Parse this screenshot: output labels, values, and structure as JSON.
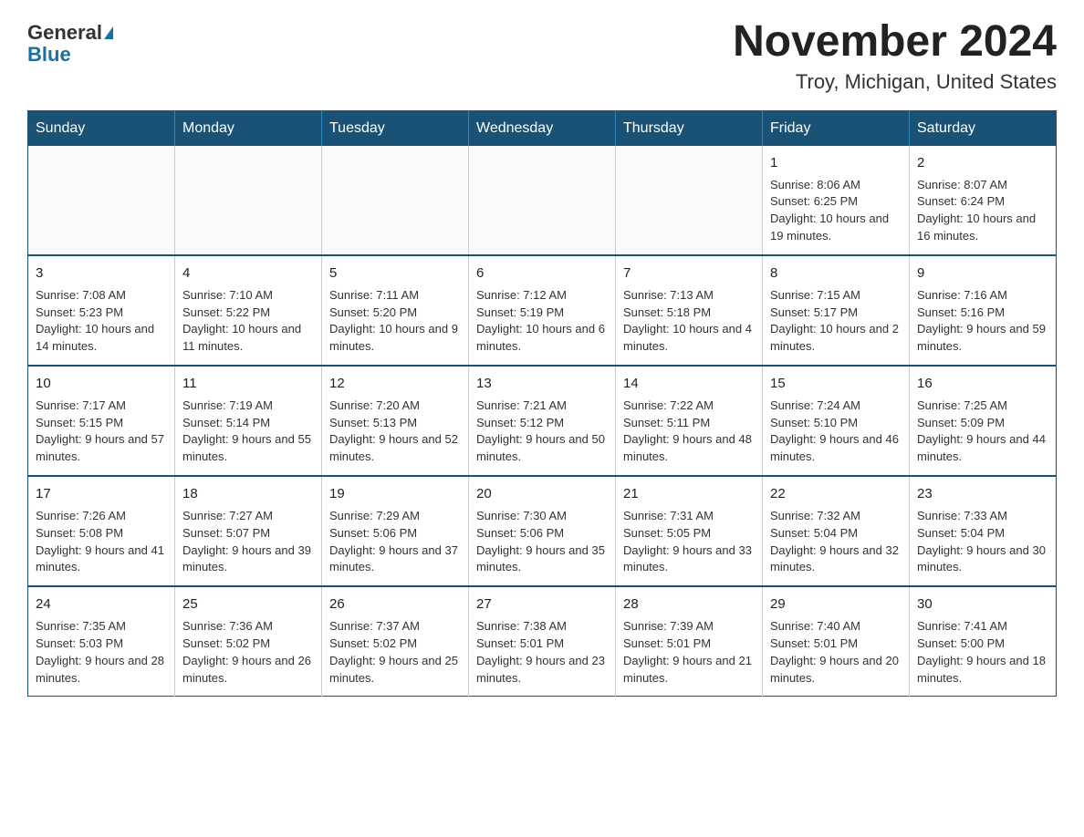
{
  "header": {
    "logo_line1": "General",
    "logo_line2": "Blue",
    "title": "November 2024",
    "subtitle": "Troy, Michigan, United States"
  },
  "days_of_week": [
    "Sunday",
    "Monday",
    "Tuesday",
    "Wednesday",
    "Thursday",
    "Friday",
    "Saturday"
  ],
  "weeks": [
    [
      {
        "num": "",
        "info": ""
      },
      {
        "num": "",
        "info": ""
      },
      {
        "num": "",
        "info": ""
      },
      {
        "num": "",
        "info": ""
      },
      {
        "num": "",
        "info": ""
      },
      {
        "num": "1",
        "info": "Sunrise: 8:06 AM\nSunset: 6:25 PM\nDaylight: 10 hours and 19 minutes."
      },
      {
        "num": "2",
        "info": "Sunrise: 8:07 AM\nSunset: 6:24 PM\nDaylight: 10 hours and 16 minutes."
      }
    ],
    [
      {
        "num": "3",
        "info": "Sunrise: 7:08 AM\nSunset: 5:23 PM\nDaylight: 10 hours and 14 minutes."
      },
      {
        "num": "4",
        "info": "Sunrise: 7:10 AM\nSunset: 5:22 PM\nDaylight: 10 hours and 11 minutes."
      },
      {
        "num": "5",
        "info": "Sunrise: 7:11 AM\nSunset: 5:20 PM\nDaylight: 10 hours and 9 minutes."
      },
      {
        "num": "6",
        "info": "Sunrise: 7:12 AM\nSunset: 5:19 PM\nDaylight: 10 hours and 6 minutes."
      },
      {
        "num": "7",
        "info": "Sunrise: 7:13 AM\nSunset: 5:18 PM\nDaylight: 10 hours and 4 minutes."
      },
      {
        "num": "8",
        "info": "Sunrise: 7:15 AM\nSunset: 5:17 PM\nDaylight: 10 hours and 2 minutes."
      },
      {
        "num": "9",
        "info": "Sunrise: 7:16 AM\nSunset: 5:16 PM\nDaylight: 9 hours and 59 minutes."
      }
    ],
    [
      {
        "num": "10",
        "info": "Sunrise: 7:17 AM\nSunset: 5:15 PM\nDaylight: 9 hours and 57 minutes."
      },
      {
        "num": "11",
        "info": "Sunrise: 7:19 AM\nSunset: 5:14 PM\nDaylight: 9 hours and 55 minutes."
      },
      {
        "num": "12",
        "info": "Sunrise: 7:20 AM\nSunset: 5:13 PM\nDaylight: 9 hours and 52 minutes."
      },
      {
        "num": "13",
        "info": "Sunrise: 7:21 AM\nSunset: 5:12 PM\nDaylight: 9 hours and 50 minutes."
      },
      {
        "num": "14",
        "info": "Sunrise: 7:22 AM\nSunset: 5:11 PM\nDaylight: 9 hours and 48 minutes."
      },
      {
        "num": "15",
        "info": "Sunrise: 7:24 AM\nSunset: 5:10 PM\nDaylight: 9 hours and 46 minutes."
      },
      {
        "num": "16",
        "info": "Sunrise: 7:25 AM\nSunset: 5:09 PM\nDaylight: 9 hours and 44 minutes."
      }
    ],
    [
      {
        "num": "17",
        "info": "Sunrise: 7:26 AM\nSunset: 5:08 PM\nDaylight: 9 hours and 41 minutes."
      },
      {
        "num": "18",
        "info": "Sunrise: 7:27 AM\nSunset: 5:07 PM\nDaylight: 9 hours and 39 minutes."
      },
      {
        "num": "19",
        "info": "Sunrise: 7:29 AM\nSunset: 5:06 PM\nDaylight: 9 hours and 37 minutes."
      },
      {
        "num": "20",
        "info": "Sunrise: 7:30 AM\nSunset: 5:06 PM\nDaylight: 9 hours and 35 minutes."
      },
      {
        "num": "21",
        "info": "Sunrise: 7:31 AM\nSunset: 5:05 PM\nDaylight: 9 hours and 33 minutes."
      },
      {
        "num": "22",
        "info": "Sunrise: 7:32 AM\nSunset: 5:04 PM\nDaylight: 9 hours and 32 minutes."
      },
      {
        "num": "23",
        "info": "Sunrise: 7:33 AM\nSunset: 5:04 PM\nDaylight: 9 hours and 30 minutes."
      }
    ],
    [
      {
        "num": "24",
        "info": "Sunrise: 7:35 AM\nSunset: 5:03 PM\nDaylight: 9 hours and 28 minutes."
      },
      {
        "num": "25",
        "info": "Sunrise: 7:36 AM\nSunset: 5:02 PM\nDaylight: 9 hours and 26 minutes."
      },
      {
        "num": "26",
        "info": "Sunrise: 7:37 AM\nSunset: 5:02 PM\nDaylight: 9 hours and 25 minutes."
      },
      {
        "num": "27",
        "info": "Sunrise: 7:38 AM\nSunset: 5:01 PM\nDaylight: 9 hours and 23 minutes."
      },
      {
        "num": "28",
        "info": "Sunrise: 7:39 AM\nSunset: 5:01 PM\nDaylight: 9 hours and 21 minutes."
      },
      {
        "num": "29",
        "info": "Sunrise: 7:40 AM\nSunset: 5:01 PM\nDaylight: 9 hours and 20 minutes."
      },
      {
        "num": "30",
        "info": "Sunrise: 7:41 AM\nSunset: 5:00 PM\nDaylight: 9 hours and 18 minutes."
      }
    ]
  ]
}
